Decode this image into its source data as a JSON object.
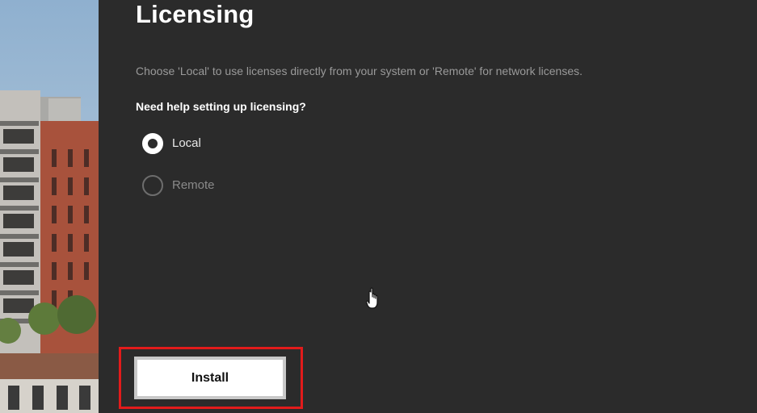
{
  "page": {
    "title": "Licensing",
    "description": "Choose 'Local' to use licenses directly from your system or 'Remote' for network licenses.",
    "question": "Need help setting up licensing?"
  },
  "license_options": {
    "selected": "Local",
    "options": [
      {
        "label": "Local",
        "checked": true
      },
      {
        "label": "Remote",
        "checked": false
      }
    ]
  },
  "actions": {
    "install_label": "Install"
  },
  "colors": {
    "background": "#2b2b2b",
    "highlight_border": "#e21b1b",
    "button_background": "#ffffff"
  },
  "icons": {
    "cursor": "hand-pointer-icon",
    "radio_checked": "radio-checked-icon",
    "radio_unchecked": "radio-unchecked-icon"
  }
}
